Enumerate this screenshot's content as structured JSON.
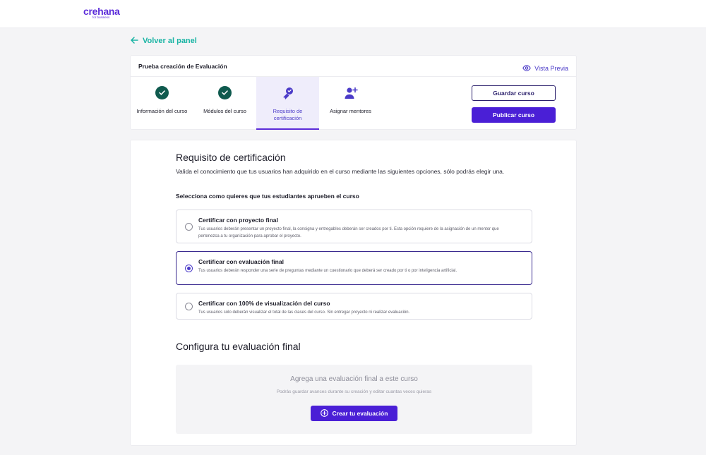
{
  "brand": {
    "name": "crehana",
    "tagline": "for business",
    "color": "#5b2bd9"
  },
  "nav": {
    "back_label": "Volver al panel"
  },
  "header": {
    "course_title": "Prueba creación de Evaluación",
    "preview_label": "Vista Previa",
    "steps": [
      {
        "label": "Información del curso",
        "icon": "check-circle-icon",
        "state": "completed"
      },
      {
        "label": "Módulos del curso",
        "icon": "check-circle-icon",
        "state": "completed"
      },
      {
        "label": "Requisito de certificación",
        "icon": "certificate-ribbon-icon",
        "state": "active"
      },
      {
        "label": "Asignar mentores",
        "icon": "add-user-icon",
        "state": "pending"
      }
    ],
    "save_label": "Guardar curso",
    "publish_label": "Publicar curso"
  },
  "certification": {
    "title": "Requisito de certificación",
    "description": "Valida el conocimiento que tus usuarios han adquirido en el curso mediante las siguientes opciones, sólo podrás elegir una.",
    "select_label": "Selecciona como quieres que tus estudiantes aprueben el curso",
    "options": [
      {
        "title": "Certificar con proyecto final",
        "description": "Tus usuarios deberán presentar un proyecto final, la consigna y entregables deberán ser creados por ti. Esta opción requiere de la asignación de un mentor que pertenezca a tu organización para aprobar el proyecto.",
        "selected": false
      },
      {
        "title": "Certificar con evaluación final",
        "description": "Tus usuarios deberán responder una serie de preguntas mediante un cuestionario que deberá ser creado por ti o por inteligencia artificial.",
        "selected": true
      },
      {
        "title": "Certificar con 100% de visualización del curso",
        "description": "Tus usuarios sólo deberán visualizar el total de las clases del curso. Sin entregar proyecto ni realizar evaluación.",
        "selected": false
      }
    ]
  },
  "evaluation": {
    "title": "Configura tu evaluación final",
    "empty_title": "Agrega una evaluación final a este curso",
    "empty_subtitle": "Podrás guardar avances durante su creación y editar cuantas veces quieras",
    "create_label": "Crear tu evaluación"
  },
  "colors": {
    "accent": "#4a1fd6",
    "teal_link": "#19b4a4",
    "completed": "#0f5a4e"
  }
}
